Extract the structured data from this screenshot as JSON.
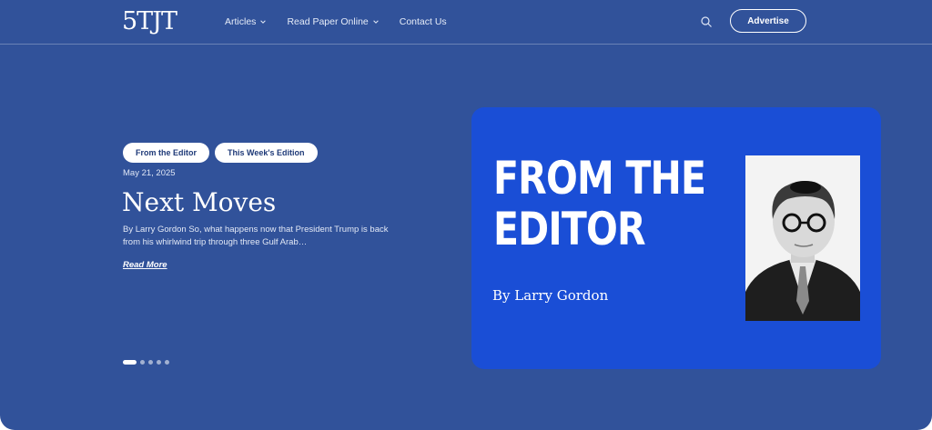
{
  "header": {
    "logo": "5TJT",
    "nav": [
      {
        "label": "Articles",
        "has_dropdown": true
      },
      {
        "label": "Read Paper Online",
        "has_dropdown": true
      },
      {
        "label": "Contact Us",
        "has_dropdown": false
      }
    ],
    "search_icon": "search-icon",
    "advertise_label": "Advertise"
  },
  "hero": {
    "tags": [
      "From the Editor",
      "This Week's Edition"
    ],
    "date": "May 21, 2025",
    "headline": "Next Moves",
    "excerpt": "By Larry Gordon So, what happens now that President Trump is back from his whirlwind trip through three Gulf Arab…",
    "read_more": "Read More",
    "slides_total": 5,
    "slide_active": 1
  },
  "feature_card": {
    "title_line1": "FROM THE",
    "title_line2": "EDITOR",
    "byline": "By Larry Gordon"
  },
  "colors": {
    "page_bg": "#31529a",
    "card_bg": "#1a4ed6",
    "text": "#ffffff"
  }
}
